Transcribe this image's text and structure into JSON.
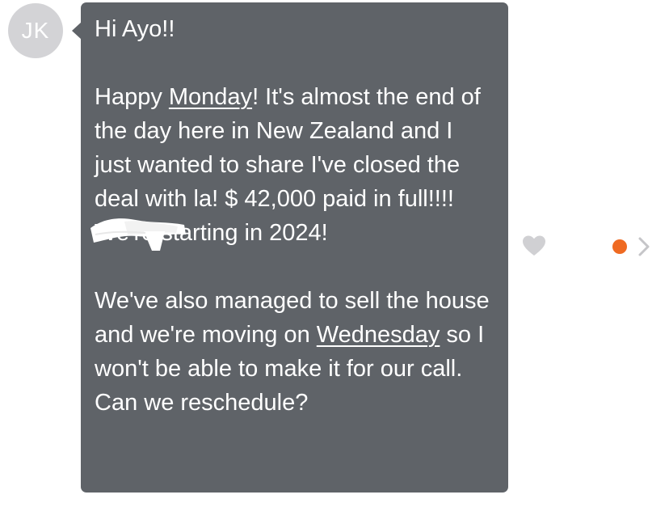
{
  "sender": {
    "initials": "JK"
  },
  "message": {
    "greeting": "Hi Ayo!!",
    "p1_a": "Happy ",
    "p1_monday": "Monday",
    "p1_b": "! It's almost the end of the day here in New Zealand and I just wanted to share I've closed the deal with ",
    "p1_redacted_fragment": "la",
    "p1_c": "! $ 42,000 paid in full!!!! We're starting in 2024!",
    "p2_a": "We've also managed to sell the house and we're moving on ",
    "p2_wednesday": "Wednesday",
    "p2_b": " so I won't be able to make it for our call. Can we reschedule?"
  },
  "actions": {
    "like_icon": "heart-icon",
    "status_icon": "unread-dot-icon",
    "open_icon": "chevron-right-icon"
  },
  "colors": {
    "bubble": "#5f6368",
    "avatar": "#d3d3d6",
    "heart": "#d0d0d3",
    "status_dot": "#ef6a22",
    "chevron": "#c5c5c8"
  }
}
